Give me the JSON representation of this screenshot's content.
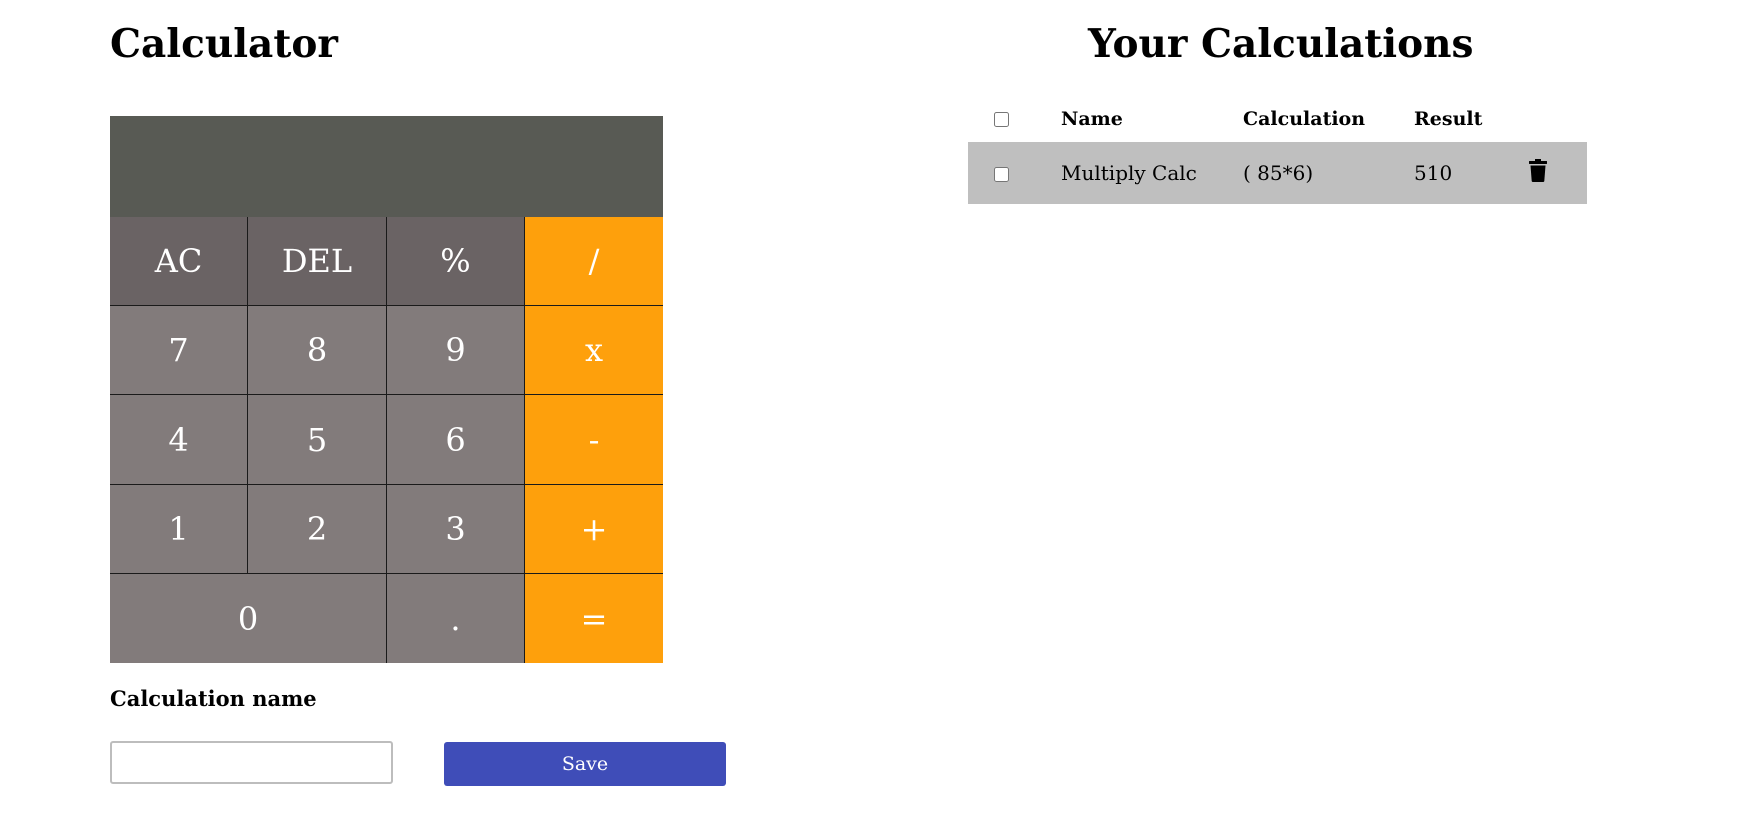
{
  "calculator": {
    "title": "Calculator",
    "display_value": "",
    "keys": {
      "ac": "AC",
      "del": "DEL",
      "percent": "%",
      "divide": "/",
      "seven": "7",
      "eight": "8",
      "nine": "9",
      "multiply": "x",
      "four": "4",
      "five": "5",
      "six": "6",
      "minus": "-",
      "one": "1",
      "two": "2",
      "three": "3",
      "plus": "+",
      "zero": "0",
      "decimal": ".",
      "equals": "="
    },
    "name_label": "Calculation name",
    "name_input_value": "",
    "save_label": "Save"
  },
  "history": {
    "title": "Your Calculations",
    "columns": {
      "name": "Name",
      "calculation": "Calculation",
      "result": "Result"
    },
    "rows": [
      {
        "name": "Multiply Calc",
        "calculation": "( 85*6)",
        "result": "510",
        "action_icon": "trash-icon"
      }
    ]
  },
  "colors": {
    "display_bg": "#585a54",
    "function_key_bg": "#6a6364",
    "number_key_bg": "#827b7b",
    "operator_key_bg": "#fea00c",
    "save_button_bg": "#3f4db8",
    "row_bg": "#bfbfbf"
  }
}
